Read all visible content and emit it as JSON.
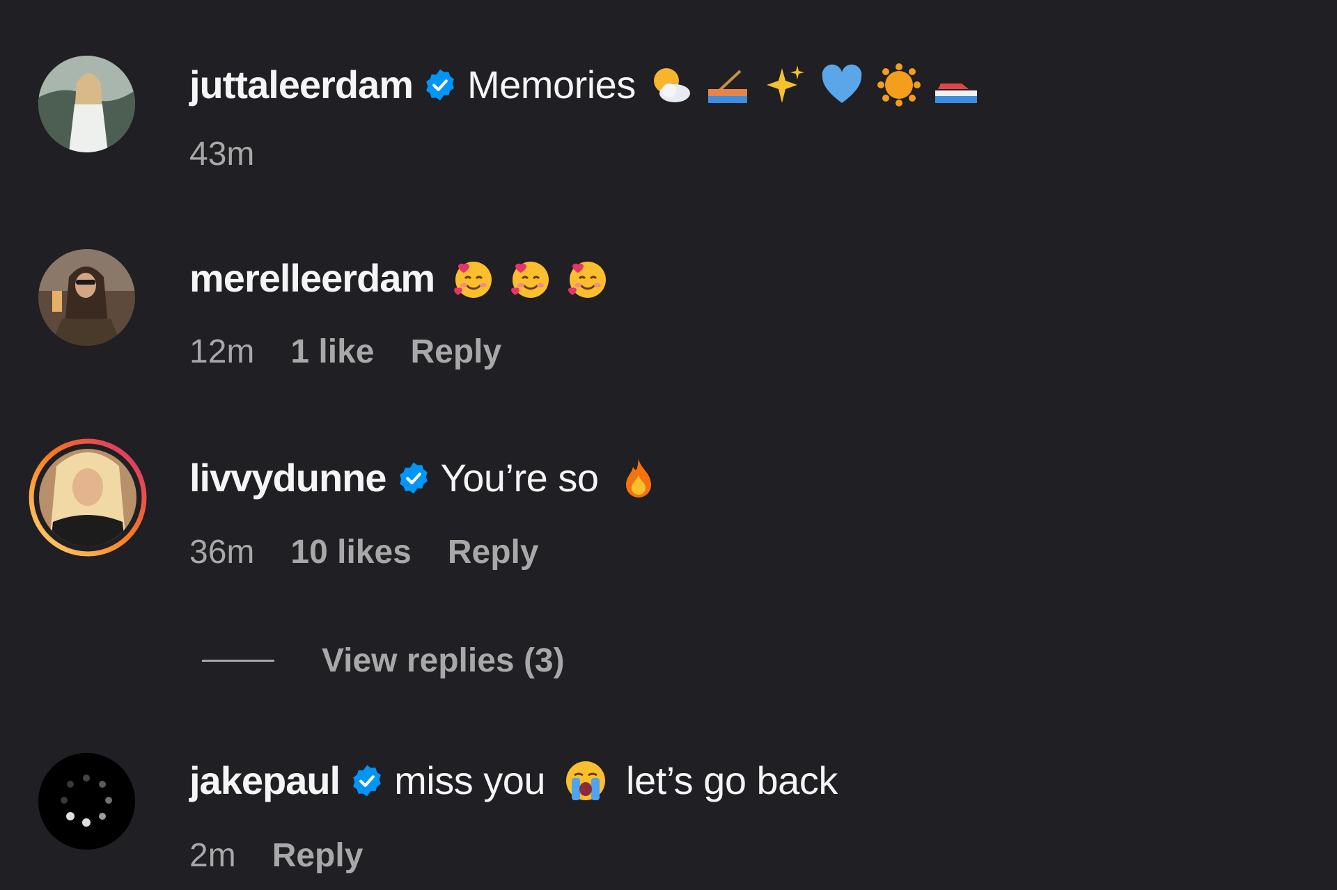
{
  "comments": [
    {
      "username": "juttaleerdam",
      "verified": true,
      "text": "Memories",
      "emojis": [
        "sun-behind-cloud",
        "rowboat",
        "sparkles",
        "blue-heart",
        "sun",
        "speedboat"
      ],
      "time": "43m"
    },
    {
      "username": "merelleerdam",
      "verified": false,
      "text": "",
      "emojis": [
        "smiling-face-with-hearts",
        "smiling-face-with-hearts",
        "smiling-face-with-hearts"
      ],
      "time": "12m",
      "likes": "1 like",
      "reply": "Reply"
    },
    {
      "username": "livvydunne",
      "verified": true,
      "text": "You’re so",
      "emojis": [
        "fire"
      ],
      "time": "36m",
      "likes": "10 likes",
      "reply": "Reply",
      "view_replies": "View replies (3)"
    },
    {
      "username": "jakepaul",
      "verified": true,
      "text_before": "miss you",
      "emojis": [
        "loudly-crying-face"
      ],
      "text_after": "let’s go back",
      "time": "2m",
      "reply": "Reply"
    }
  ],
  "colors": {
    "background": "#1f1f24",
    "verified": "#0095f6",
    "meta": "#a8a8a8",
    "story_ring_start": "#feda75",
    "story_ring_end": "#d62976"
  }
}
